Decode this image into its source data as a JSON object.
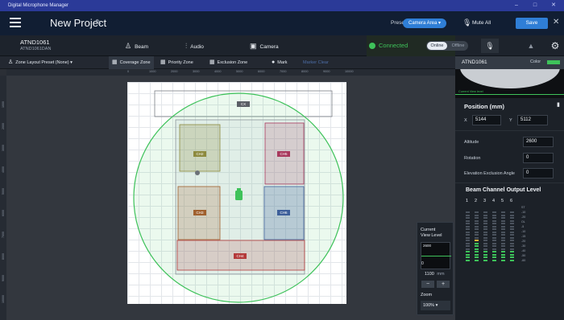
{
  "window": {
    "title": "Digital Microphone Manager",
    "min": "–",
    "max": "□",
    "close": "✕"
  },
  "project": {
    "title": "New Project",
    "preset_label": "Preset",
    "preset_value": "Camera Area ▾",
    "mute_all": "Mute All",
    "save": "Save"
  },
  "device": {
    "name": "ATND1061",
    "model": "ATND1061DAN"
  },
  "tabs": [
    {
      "label": "Beam",
      "icon": "person-icon"
    },
    {
      "label": "Audio",
      "icon": "equalizer-icon"
    },
    {
      "label": "Camera",
      "icon": "camera-icon"
    }
  ],
  "status": {
    "connected": "Connected",
    "online": "Online",
    "offline": "Offline"
  },
  "toolbar": {
    "zone_preset": "Zone Layout Preset (None) ▾",
    "coverage": "Coverage Zone",
    "priority": "Priority Zone",
    "exclusion": "Exclusion Zone",
    "mark": "Mark",
    "marker_clear": "Marker Clear"
  },
  "ruler": {
    "top": [
      "0",
      "1000",
      "2000",
      "3000",
      "4000",
      "5000",
      "6000",
      "7000",
      "8000",
      "9000",
      "10000"
    ],
    "left": [
      "1000",
      "2000",
      "3000",
      "4000",
      "5000",
      "6000",
      "7000",
      "8000",
      "9000",
      "10000"
    ]
  },
  "zones": {
    "cx": "CX",
    "ch2": "CH2",
    "ch3": "CH3",
    "ch4": "CH4",
    "ch5": "CH5",
    "ch6": "CH6"
  },
  "colors": {
    "ch2": "#8d8a3e",
    "ch3": "#a0602e",
    "ch4": "#b43a3a",
    "ch5": "#a8395d",
    "ch6": "#3d5f9a",
    "cx": "#5b5f66",
    "coverage": "#3ec25a",
    "accent": "#2f7ed6"
  },
  "panel": {
    "device": "ATND1061",
    "color_label": "Color",
    "current_view_level": "Current View level",
    "position_title": "Position (mm)",
    "x_label": "X",
    "x_value": "5144",
    "y_label": "Y",
    "y_value": "5112",
    "altitude_label": "Altitude",
    "altitude_value": "2600",
    "rotation_label": "Rotation",
    "rotation_value": "0",
    "elev_label": "Elevation Exclusion Angle",
    "elev_value": "0",
    "beam_title": "Beam Channel Output Level",
    "channels": [
      "1",
      "2",
      "3",
      "4",
      "5",
      "6"
    ],
    "meter_levels": [
      0.22,
      0.42,
      0.22,
      0.22,
      0.22,
      0.22
    ],
    "scale": [
      "ST",
      "-10",
      "-20",
      "OL",
      "-5",
      "-10",
      "-15",
      "-20",
      "-30",
      "-40",
      "-50",
      "-60"
    ]
  },
  "view_level": {
    "title1": "Current",
    "title2": "View Level",
    "top_value": "2600",
    "bottom_value": "0",
    "value": "1100",
    "unit": "mm",
    "minus": "−",
    "plus": "+",
    "zoom_label": "Zoom",
    "zoom_value": "100% ▾"
  }
}
